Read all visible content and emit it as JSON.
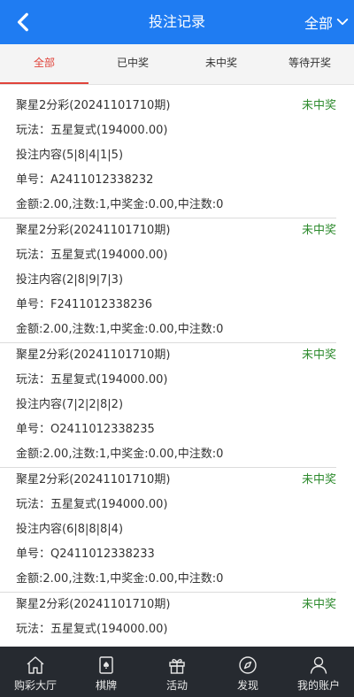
{
  "header": {
    "title": "投注记录",
    "filter_label": "全部"
  },
  "tabs": [
    "全部",
    "已中奖",
    "未中奖",
    "等待开奖"
  ],
  "records": [
    {
      "game": "聚星2分彩(20241101710期)",
      "status": "未中奖",
      "play": "玩法：五星复式(194000.00)",
      "content": "投注内容(5|8|4|1|5)",
      "order": "单号：A2411012338232",
      "summary": "金额:2.00,注数:1,中奖金:0.00,中注数:0"
    },
    {
      "game": "聚星2分彩(20241101710期)",
      "status": "未中奖",
      "play": "玩法：五星复式(194000.00)",
      "content": "投注内容(2|8|9|7|3)",
      "order": "单号：F2411012338236",
      "summary": "金额:2.00,注数:1,中奖金:0.00,中注数:0"
    },
    {
      "game": "聚星2分彩(20241101710期)",
      "status": "未中奖",
      "play": "玩法：五星复式(194000.00)",
      "content": "投注内容(7|2|2|8|2)",
      "order": "单号：O2411012338235",
      "summary": "金额:2.00,注数:1,中奖金:0.00,中注数:0"
    },
    {
      "game": "聚星2分彩(20241101710期)",
      "status": "未中奖",
      "play": "玩法：五星复式(194000.00)",
      "content": "投注内容(6|8|8|8|4)",
      "order": "单号：Q2411012338233",
      "summary": "金额:2.00,注数:1,中奖金:0.00,中注数:0"
    },
    {
      "game": "聚星2分彩(20241101710期)",
      "status": "未中奖",
      "play": "玩法：五星复式(194000.00)",
      "content": "",
      "order": "",
      "summary": ""
    }
  ],
  "tabbar": [
    {
      "label": "购彩大厅",
      "icon": "home-icon"
    },
    {
      "label": "棋牌",
      "icon": "card-icon"
    },
    {
      "label": "活动",
      "icon": "gift-icon"
    },
    {
      "label": "发现",
      "icon": "compass-icon"
    },
    {
      "label": "我的账户",
      "icon": "user-icon"
    }
  ],
  "colors": {
    "header": "#1f7cf2",
    "active_tab": "#e0443b",
    "status": "#2e8b2e",
    "tabbar": "#262a30"
  }
}
